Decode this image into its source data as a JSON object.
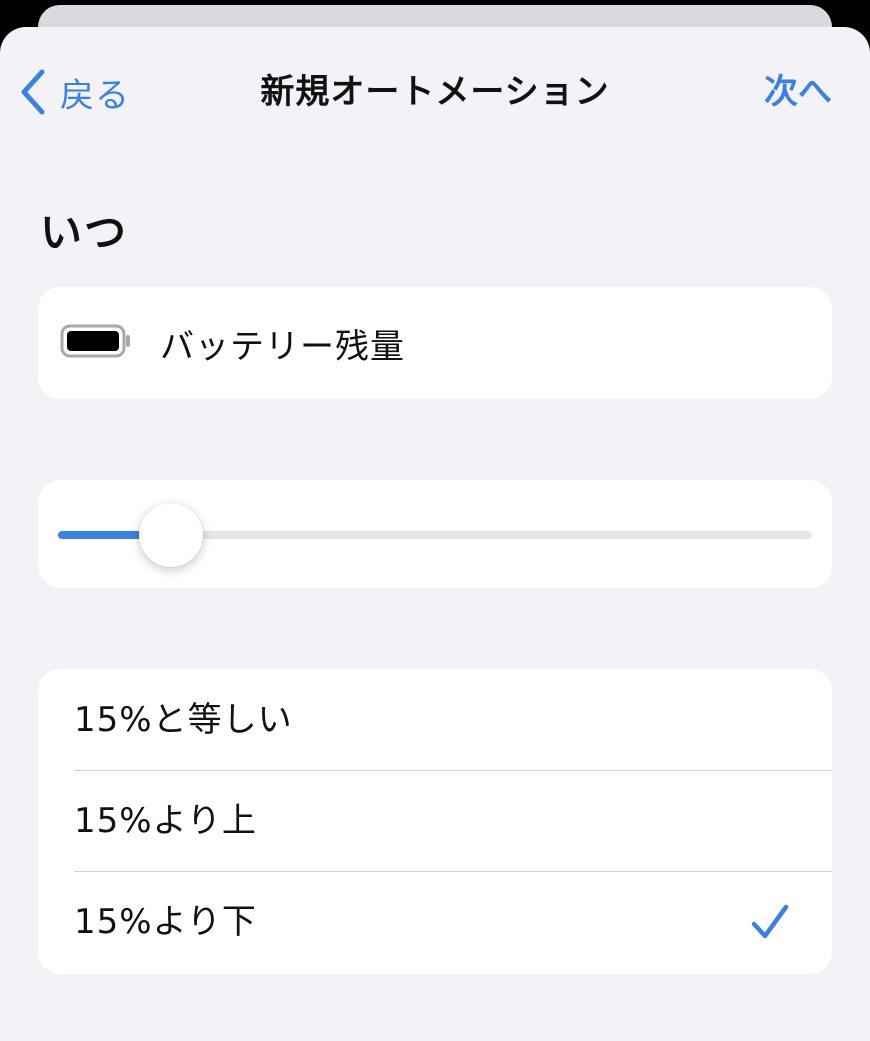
{
  "colors": {
    "accent": "#3b82e0",
    "background": "#f2f2f7",
    "card": "#ffffff",
    "text": "#111111"
  },
  "nav": {
    "back_label": "戻る",
    "back_icon": "chevron-left-icon",
    "title": "新規オートメーション",
    "next_label": "次へ"
  },
  "section": {
    "title": "いつ"
  },
  "trigger": {
    "icon": "battery-icon",
    "label": "バッテリー残量"
  },
  "slider": {
    "value_percent": 15
  },
  "options": [
    {
      "label": "15%と等しい",
      "selected": false
    },
    {
      "label": "15%より上",
      "selected": false
    },
    {
      "label": "15%より下",
      "selected": true
    }
  ]
}
